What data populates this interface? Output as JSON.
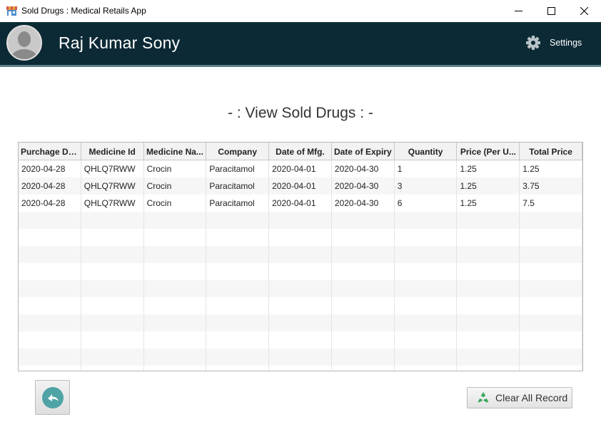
{
  "window": {
    "title": "Sold Drugs : Medical Retails App"
  },
  "header": {
    "username": "Raj Kumar Sony",
    "settings_label": "Settings"
  },
  "page": {
    "heading": "- : View Sold Drugs : -"
  },
  "table": {
    "columns": [
      "Purchage Date",
      "Medicine Id",
      "Medicine Na...",
      "Company",
      "Date of Mfg.",
      "Date of Expiry",
      "Quantity",
      "Price  (Per U...",
      "Total Price"
    ],
    "rows": [
      [
        "2020-04-28",
        "QHLQ7RWW",
        "Crocin",
        "Paracitamol",
        "2020-04-01",
        "2020-04-30",
        "1",
        "1.25",
        "1.25"
      ],
      [
        "2020-04-28",
        "QHLQ7RWW",
        "Crocin",
        "Paracitamol",
        "2020-04-01",
        "2020-04-30",
        "3",
        "1.25",
        "3.75"
      ],
      [
        "2020-04-28",
        "QHLQ7RWW",
        "Crocin",
        "Paracitamol",
        "2020-04-01",
        "2020-04-30",
        "6",
        "1.25",
        "7.5"
      ]
    ]
  },
  "buttons": {
    "clear_label": "Clear All Record"
  },
  "colors": {
    "header_bg": "#0c2a35",
    "accent": "#4fa3a5",
    "recycle": "#3aa65a"
  }
}
